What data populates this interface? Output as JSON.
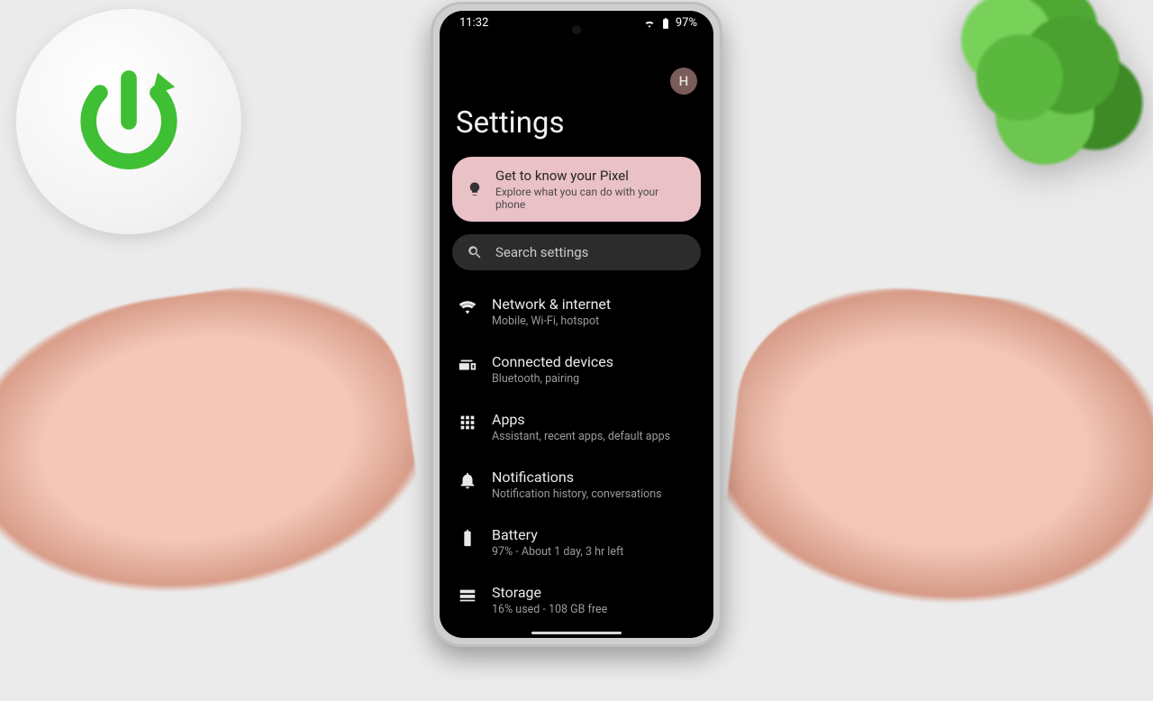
{
  "statusbar": {
    "time": "11:32",
    "battery_pct": "97%"
  },
  "header": {
    "avatar_initial": "H",
    "title": "Settings"
  },
  "promo": {
    "title": "Get to know your Pixel",
    "subtitle": "Explore what you can do with your phone"
  },
  "search": {
    "placeholder": "Search settings"
  },
  "items": [
    {
      "icon": "wifi",
      "title": "Network & internet",
      "subtitle": "Mobile, Wi-Fi, hotspot"
    },
    {
      "icon": "devices",
      "title": "Connected devices",
      "subtitle": "Bluetooth, pairing"
    },
    {
      "icon": "apps",
      "title": "Apps",
      "subtitle": "Assistant, recent apps, default apps"
    },
    {
      "icon": "bell",
      "title": "Notifications",
      "subtitle": "Notification history, conversations"
    },
    {
      "icon": "battery",
      "title": "Battery",
      "subtitle": "97% - About 1 day, 3 hr left"
    },
    {
      "icon": "storage",
      "title": "Storage",
      "subtitle": "16% used - 108 GB free"
    }
  ]
}
